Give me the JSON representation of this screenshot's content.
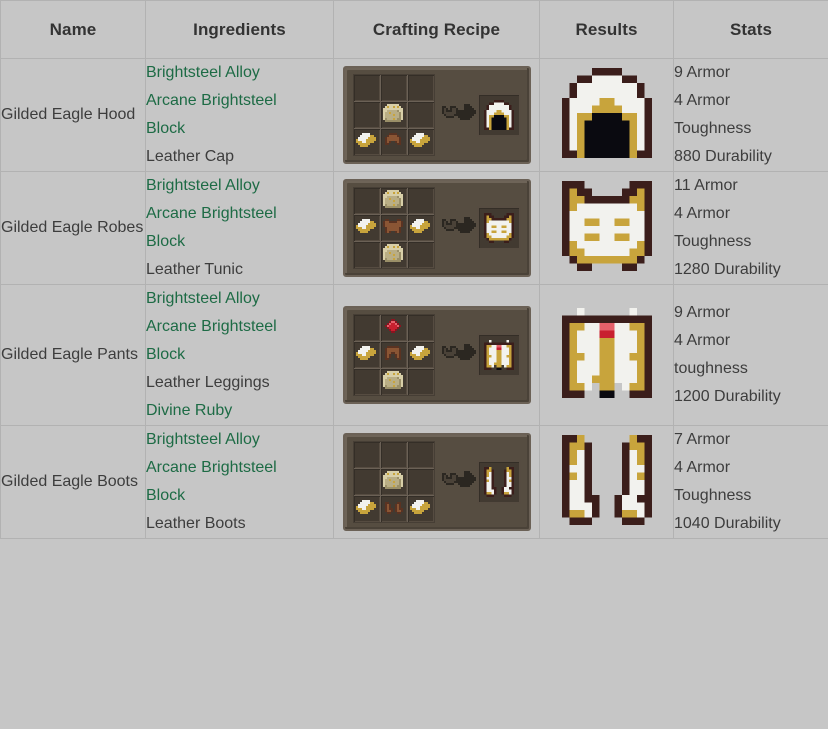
{
  "table": {
    "columns": [
      {
        "key": "name",
        "label": "Name"
      },
      {
        "key": "ing",
        "label": "Ingredients"
      },
      {
        "key": "craft",
        "label": "Crafting Recipe"
      },
      {
        "key": "result",
        "label": "Results"
      },
      {
        "key": "stats",
        "label": "Stats"
      }
    ],
    "rows": [
      {
        "name": "Gilded Eagle Hood",
        "ingredients": [
          {
            "text": "Brightsteel Alloy",
            "link": true
          },
          {
            "text": "Arcane Brightsteel",
            "link": true
          },
          {
            "text": "Block",
            "link": true
          },
          {
            "text": "Leather Cap",
            "link": false
          }
        ],
        "recipe_grid": [
          [
            "",
            "",
            ""
          ],
          [
            "",
            "block",
            ""
          ],
          [
            "ingot",
            "cap",
            "ingot"
          ]
        ],
        "result_item": "hood",
        "stats": [
          "9 Armor",
          "4 Armor",
          "Toughness",
          "880 Durability"
        ]
      },
      {
        "name": "Gilded Eagle Robes",
        "ingredients": [
          {
            "text": "Brightsteel Alloy",
            "link": true
          },
          {
            "text": "Arcane Brightsteel",
            "link": true
          },
          {
            "text": "Block",
            "link": true
          },
          {
            "text": "Leather Tunic",
            "link": false
          }
        ],
        "recipe_grid": [
          [
            "",
            "block",
            ""
          ],
          [
            "ingot",
            "tunic",
            "ingot"
          ],
          [
            "",
            "block",
            ""
          ]
        ],
        "result_item": "chestplate",
        "stats": [
          "11 Armor",
          "4 Armor",
          "Toughness",
          "1280 Durability"
        ]
      },
      {
        "name": "Gilded Eagle Pants",
        "ingredients": [
          {
            "text": "Brightsteel Alloy",
            "link": true
          },
          {
            "text": "Arcane Brightsteel",
            "link": true
          },
          {
            "text": "Block",
            "link": true
          },
          {
            "text": "Leather Leggings",
            "link": false
          },
          {
            "text": "Divine Ruby",
            "link": true
          }
        ],
        "recipe_grid": [
          [
            "",
            "ruby",
            ""
          ],
          [
            "ingot",
            "leggings",
            "ingot"
          ],
          [
            "",
            "block",
            ""
          ]
        ],
        "result_item": "leggings",
        "stats": [
          "9 Armor",
          "4 Armor",
          "toughness",
          "1200 Durability"
        ]
      },
      {
        "name": "Gilded Eagle Boots",
        "ingredients": [
          {
            "text": "Brightsteel Alloy",
            "link": true
          },
          {
            "text": "Arcane Brightsteel",
            "link": true
          },
          {
            "text": "Block",
            "link": true
          },
          {
            "text": "Leather Boots",
            "link": false
          }
        ],
        "recipe_grid": [
          [
            "",
            "",
            ""
          ],
          [
            "",
            "block",
            ""
          ],
          [
            "ingot",
            "boots",
            "ingot"
          ]
        ],
        "result_item": "boots",
        "stats": [
          "7 Armor",
          "4 Armor",
          "Toughness",
          "1040 Durability"
        ]
      }
    ]
  },
  "icons": {
    "arrow": "craft-arrow-icon",
    "ingot": "brightsteel-ingot-icon",
    "block": "brightsteel-block-icon",
    "ruby": "divine-ruby-icon",
    "cap": "leather-cap-icon",
    "tunic": "leather-tunic-icon",
    "leggings": "leather-leggings-icon",
    "boots": "leather-boots-icon",
    "hood": "gilded-eagle-hood-icon",
    "chestplate": "gilded-eagle-robes-icon",
    "leggings_result": "gilded-eagle-pants-icon",
    "boots_result": "gilded-eagle-boots-icon"
  },
  "colors": {
    "page_bg": "#c6c6c6",
    "border": "#b2b2b2",
    "text": "#3d3d3d",
    "header_text": "#333333",
    "link": "#1d6b45",
    "panel_bg": "#564d41",
    "slot_bg": "#423a31",
    "gold": "#c8a43c",
    "white": "#f2f2ee",
    "leather": "#8a5534",
    "ruby": "#c8202f",
    "dark_brown": "#3b1e1b"
  }
}
